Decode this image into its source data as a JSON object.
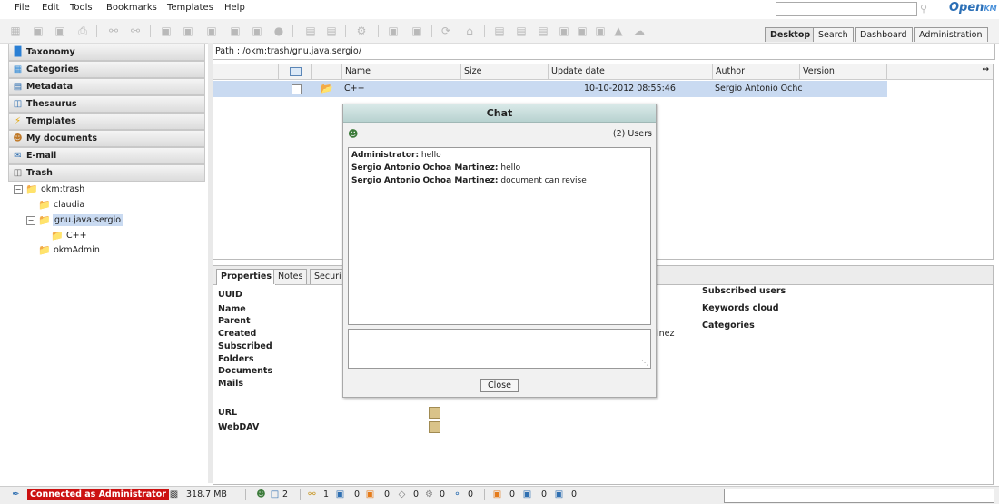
{
  "menu": [
    "File",
    "Edit",
    "Tools",
    "Bookmarks",
    "Templates",
    "Help"
  ],
  "brand": {
    "logo": "Open",
    "logo_suffix": "KM"
  },
  "main_tabs": [
    {
      "label": "Desktop",
      "active": true
    },
    {
      "label": "Search",
      "active": false
    },
    {
      "label": "Dashboard",
      "active": false
    },
    {
      "label": "Administration",
      "active": false
    }
  ],
  "left_stack": [
    {
      "label": "Taxonomy",
      "icon": "taxonomy-icon"
    },
    {
      "label": "Categories",
      "icon": "categories-icon"
    },
    {
      "label": "Metadata",
      "icon": "metadata-icon"
    },
    {
      "label": "Thesaurus",
      "icon": "thesaurus-icon"
    },
    {
      "label": "Templates",
      "icon": "templates-icon"
    },
    {
      "label": "My documents",
      "icon": "user-icon"
    },
    {
      "label": "E-mail",
      "icon": "email-icon"
    },
    {
      "label": "Trash",
      "icon": "trash-icon"
    }
  ],
  "tree": {
    "root": "okm:trash",
    "claudia": "claudia",
    "selected": "gnu.java.sergio",
    "child": "C++",
    "admin": "okmAdmin"
  },
  "path": "Path : /okm:trash/gnu.java.sergio/",
  "grid": {
    "columns": [
      "Name",
      "Size",
      "Update date",
      "Author",
      "Version"
    ],
    "row": {
      "name": "C++",
      "size": "",
      "date": "10-10-2012 08:55:46",
      "author": "Sergio Antonio Ochc",
      "version": ""
    }
  },
  "properties": {
    "tabs": [
      "Properties",
      "Notes",
      "Securi"
    ],
    "labels": [
      "UUID",
      "Name",
      "Parent",
      "Created",
      "Subscribed",
      "Folders",
      "Documents",
      "Mails"
    ],
    "url_label": "URL",
    "webdav_label": "WebDAV",
    "right_labels": [
      "Subscribed users",
      "Keywords cloud",
      "Categories"
    ],
    "created_by_fragment": "inez"
  },
  "chat": {
    "title": "Chat",
    "users": "(2) Users",
    "messages": [
      {
        "author": "Administrator:",
        "text": " hello"
      },
      {
        "author": "Sergio Antonio Ochoa Martinez:",
        "text": " hello"
      },
      {
        "author": "Sergio Antonio Ochoa Martinez:",
        "text": " document can revise"
      }
    ],
    "close": "Close"
  },
  "status": {
    "user": "Connected as Administrator",
    "memory": "318.7 MB",
    "users_count": "2",
    "locked": "1",
    "checked_out": "0",
    "new_docs": "0",
    "tags": "0",
    "gears": "0",
    "subs": "0",
    "mail": "0",
    "folders": "0",
    "docs": "0"
  },
  "colors": {
    "accent": "#2b6fb6",
    "selection": "#c9daf1",
    "status_user_bg": "#cc1111"
  }
}
